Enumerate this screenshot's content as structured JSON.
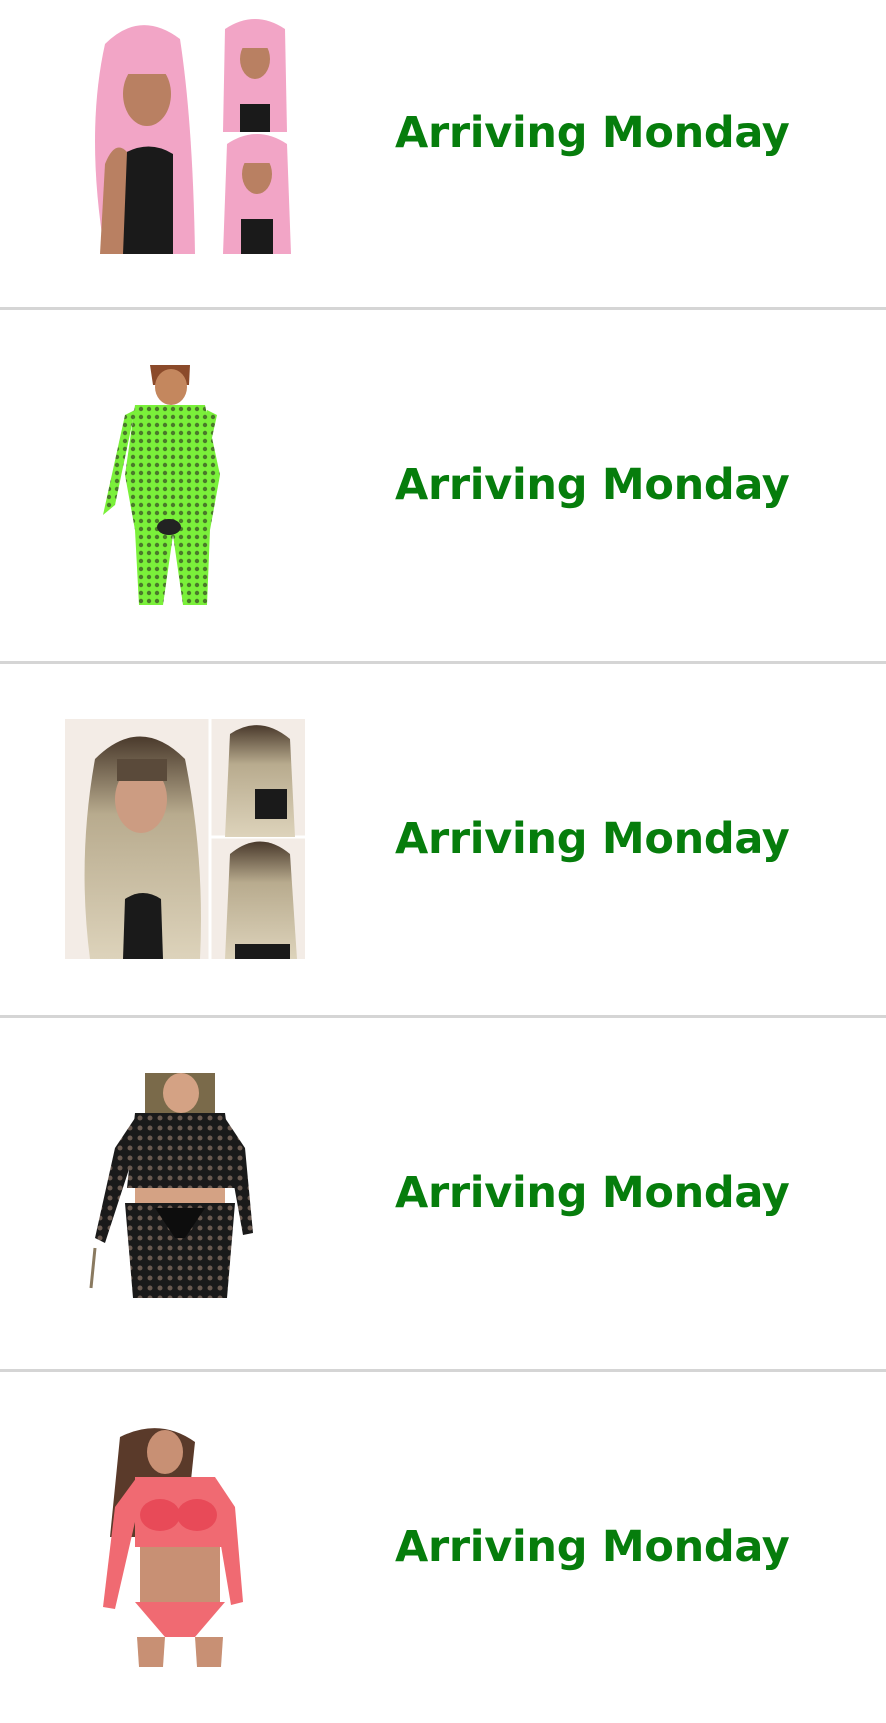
{
  "colors": {
    "status_green": "#067d0c",
    "divider": "#d5d5d5",
    "background": "#ffffff"
  },
  "orders": {
    "items": [
      {
        "status": "Arriving Monday",
        "image_icon": "pink-wig-product-image"
      },
      {
        "status": "Arriving Monday",
        "image_icon": "green-fishnet-bodystocking-product-image"
      },
      {
        "status": "Arriving Monday",
        "image_icon": "ombre-wig-product-image"
      },
      {
        "status": "Arriving Monday",
        "image_icon": "black-lace-set-product-image"
      },
      {
        "status": "Arriving Monday",
        "image_icon": "pink-lingerie-set-product-image"
      }
    ]
  }
}
